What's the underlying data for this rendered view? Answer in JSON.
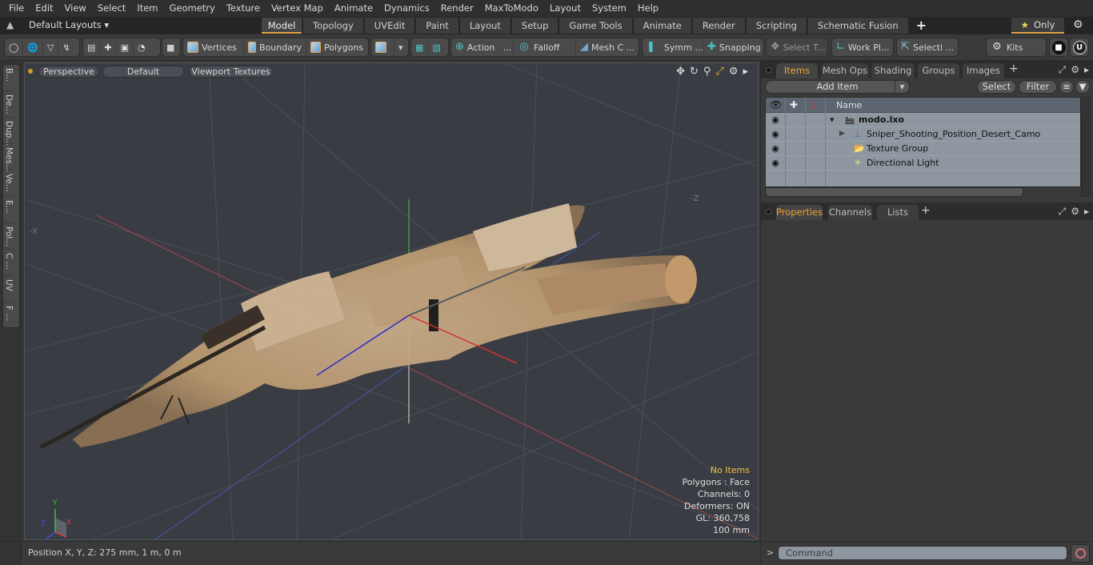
{
  "menubar": {
    "items": [
      "File",
      "Edit",
      "View",
      "Select",
      "Item",
      "Geometry",
      "Texture",
      "Vertex Map",
      "Animate",
      "Dynamics",
      "Render",
      "MaxToModo",
      "Layout",
      "System",
      "Help"
    ]
  },
  "layoutbar": {
    "layouts_label": "Default Layouts ▾",
    "tabs": [
      "Model",
      "Topology",
      "UVEdit",
      "Paint",
      "Layout",
      "Setup",
      "Game Tools",
      "Animate",
      "Render",
      "Scripting",
      "Schematic Fusion"
    ],
    "active_tab": "Model",
    "only_label": "Only"
  },
  "toolbar": {
    "vertices": "Vertices",
    "boundary": "Boundary",
    "polygons": "Polygons",
    "action": "Action",
    "action_more": "...",
    "falloff": "Falloff",
    "mesh_c": "Mesh C ...",
    "symm": "Symm ...",
    "snapping": "Snapping",
    "select_t": "Select T...",
    "work_pl": "Work Pl...",
    "selecti": "Selecti ...",
    "kits": "Kits"
  },
  "left_strip": {
    "tabs": [
      "B...",
      "De...",
      "Dup...",
      "Mes...",
      "Ve...",
      "E...",
      "Pol...",
      "C ...",
      "UV",
      "F ..."
    ]
  },
  "viewport": {
    "view_mode": "Perspective",
    "shading": "Default",
    "textures": "Viewport Textures",
    "axis_labels": {
      "neg_x": "-X",
      "neg_z": "-Z"
    },
    "info": {
      "selection": "No Items",
      "polygons": "Polygons : Face",
      "channels": "Channels: 0",
      "deformers": "Deformers: ON",
      "gl": "GL: 360,758",
      "scale": "100 mm"
    },
    "gizmo": {
      "x": "X",
      "y": "Y",
      "z": "Z"
    }
  },
  "statusbar": {
    "position": "Position X, Y, Z:   275 mm, 1 m, 0 m"
  },
  "items_panel": {
    "tabs": [
      "Items",
      "Mesh Ops",
      "Shading",
      "Groups",
      "Images"
    ],
    "active_tab": "Items",
    "add_item": "Add Item",
    "select": "Select",
    "filter": "Filter",
    "column_name": "Name",
    "rows": [
      {
        "name": "modo.lxo",
        "icon": "scene-icon",
        "bold": true
      },
      {
        "name": "Sniper_Shooting_Position_Desert_Camo",
        "icon": "mesh-locator-icon",
        "bold": false
      },
      {
        "name": "Texture Group",
        "icon": "texture-group-icon",
        "bold": false
      },
      {
        "name": "Directional Light",
        "icon": "light-icon",
        "bold": false
      }
    ]
  },
  "properties_panel": {
    "tabs": [
      "Properties",
      "Channels",
      "Lists"
    ],
    "active_tab": "Properties"
  },
  "command": {
    "prompt": ">",
    "placeholder": "Command"
  },
  "colors": {
    "accent": "#e3a34a",
    "active_tab_text": "#f0a530",
    "info_highlight": "#f2c14a",
    "axis_x": "#d04040",
    "axis_y": "#40c040",
    "axis_z": "#4050c0"
  }
}
